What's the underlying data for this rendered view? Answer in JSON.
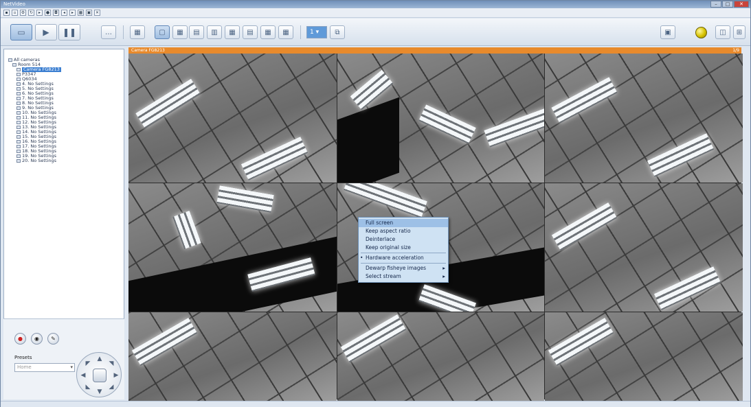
{
  "window": {
    "title": "NetVideo"
  },
  "toolbar": {
    "page_select": "1"
  },
  "tree": {
    "items": [
      {
        "label": "All cameras",
        "level": 0
      },
      {
        "label": "Room 514",
        "level": 1
      },
      {
        "label": "Camera FG8213",
        "level": 2,
        "selected": true
      },
      {
        "label": "P3347",
        "level": 2
      },
      {
        "label": "Q6034",
        "level": 2
      },
      {
        "label": "4. No Settings",
        "level": 2
      },
      {
        "label": "5. No Settings",
        "level": 2
      },
      {
        "label": "6. No Settings",
        "level": 2
      },
      {
        "label": "7. No Settings",
        "level": 2
      },
      {
        "label": "8. No Settings",
        "level": 2
      },
      {
        "label": "9. No Settings",
        "level": 2
      },
      {
        "label": "10. No Settings",
        "level": 2
      },
      {
        "label": "11. No Settings",
        "level": 2
      },
      {
        "label": "12. No Settings",
        "level": 2
      },
      {
        "label": "13. No Settings",
        "level": 2
      },
      {
        "label": "14. No Settings",
        "level": 2
      },
      {
        "label": "15. No Settings",
        "level": 2
      },
      {
        "label": "16. No Settings",
        "level": 2
      },
      {
        "label": "17. No Settings",
        "level": 2
      },
      {
        "label": "18. No Settings",
        "level": 2
      },
      {
        "label": "19. No Settings",
        "level": 2
      },
      {
        "label": "20. No Settings",
        "level": 2
      }
    ]
  },
  "controls": {
    "preset_label": "Presets",
    "preset_value": "Home"
  },
  "video": {
    "header_title": "Camera FG8213",
    "header_right": "1/9"
  },
  "context_menu": {
    "items": [
      {
        "label": "Full screen",
        "highlight": true
      },
      {
        "label": "Keep aspect ratio"
      },
      {
        "label": "Deinterlace"
      },
      {
        "label": "Keep original size"
      },
      {
        "sep": true
      },
      {
        "label": "Hardware acceleration",
        "check": true
      },
      {
        "sep": true
      },
      {
        "label": "Dewarp fisheye images",
        "submenu": true
      },
      {
        "label": "Select stream",
        "submenu": true
      }
    ]
  }
}
